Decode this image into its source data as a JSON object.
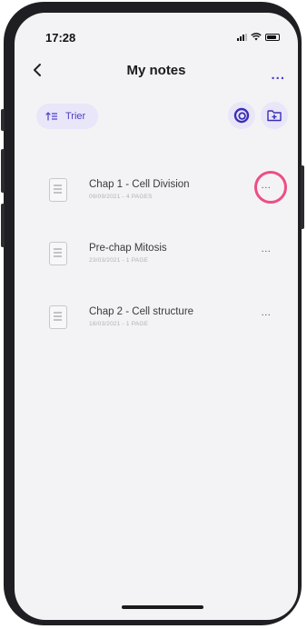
{
  "status_bar": {
    "time": "17:28"
  },
  "header": {
    "title": "My notes",
    "more_label": "..."
  },
  "toolbar": {
    "sort_label": "Trier"
  },
  "notes": [
    {
      "title": "Chap 1 - Cell Division",
      "meta": "09/09/2021 - 4 PAGES",
      "more": "...",
      "highlighted": true
    },
    {
      "title": "Pre-chap Mitosis",
      "meta": "23/03/2021 - 1 PAGE",
      "more": "...",
      "highlighted": false
    },
    {
      "title": "Chap 2 - Cell structure",
      "meta": "18/03/2021 - 1 PAGE",
      "more": "...",
      "highlighted": false
    }
  ],
  "colors": {
    "accent": "#4b3ec7",
    "highlight": "#ee4d86",
    "background": "#f3f3f5"
  }
}
